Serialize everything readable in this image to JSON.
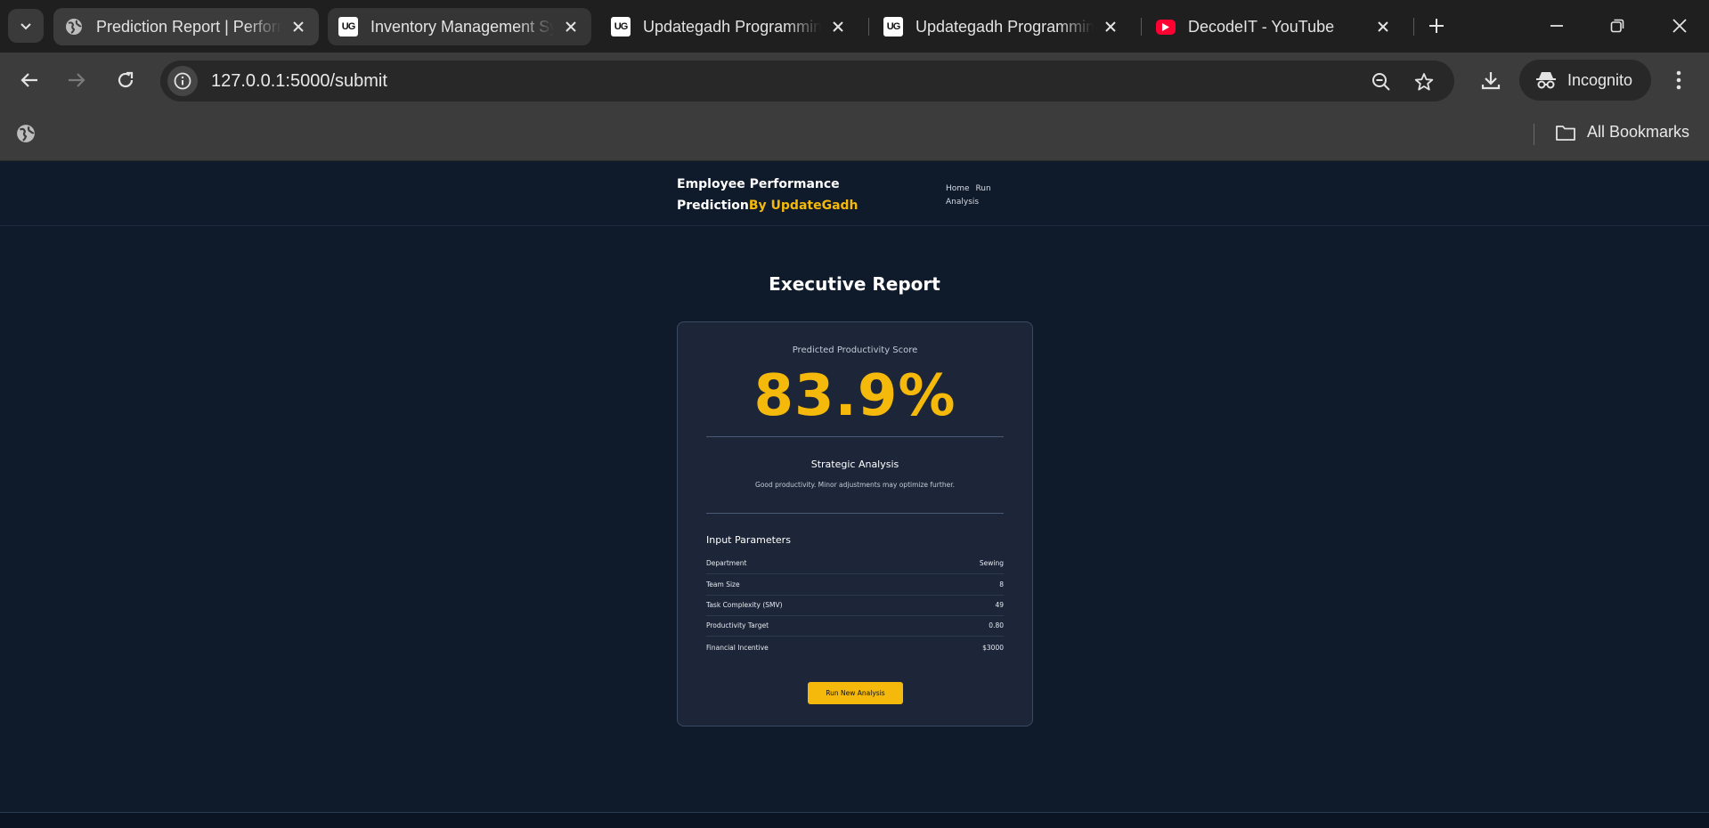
{
  "browser": {
    "tabs": [
      {
        "title": "Prediction Report | Performance",
        "favicon": "globe-icon"
      },
      {
        "title": "Inventory Management System",
        "favicon": "ug-logo"
      },
      {
        "title": "Updategadh Programming",
        "favicon": "ug-logo"
      },
      {
        "title": "Updategadh Programming",
        "favicon": "ug-logo"
      },
      {
        "title": "DecodeIT - YouTube",
        "favicon": "youtube-logo"
      }
    ],
    "url": "127.0.0.1:5000/submit",
    "incognito_label": "Incognito",
    "all_bookmarks_label": "All Bookmarks",
    "favicon_ug_text": "UG"
  },
  "site": {
    "brand_main": "Employee Performance Prediction",
    "brand_highlight": "By UpdateGadh",
    "nav": {
      "home": "Home",
      "run_analysis": "Run Analysis"
    }
  },
  "report": {
    "title": "Executive Report",
    "score_label": "Predicted Productivity Score",
    "score_value": "83.9%",
    "strategic_title": "Strategic Analysis",
    "strategic_text": "Good productivity. Minor adjustments may optimize further.",
    "inputs_title": "Input Parameters",
    "params": [
      {
        "label": "Department",
        "value": "Sewing"
      },
      {
        "label": "Team Size",
        "value": "8"
      },
      {
        "label": "Task Complexity (SMV)",
        "value": "49"
      },
      {
        "label": "Productivity Target",
        "value": "0.80"
      },
      {
        "label": "Financial Incentive",
        "value": "$3000"
      }
    ],
    "cta_label": "Run New Analysis"
  },
  "colors": {
    "accent": "#f5b90b",
    "page_bg": "#0f1a2b",
    "card_bg": "#1c2638"
  }
}
